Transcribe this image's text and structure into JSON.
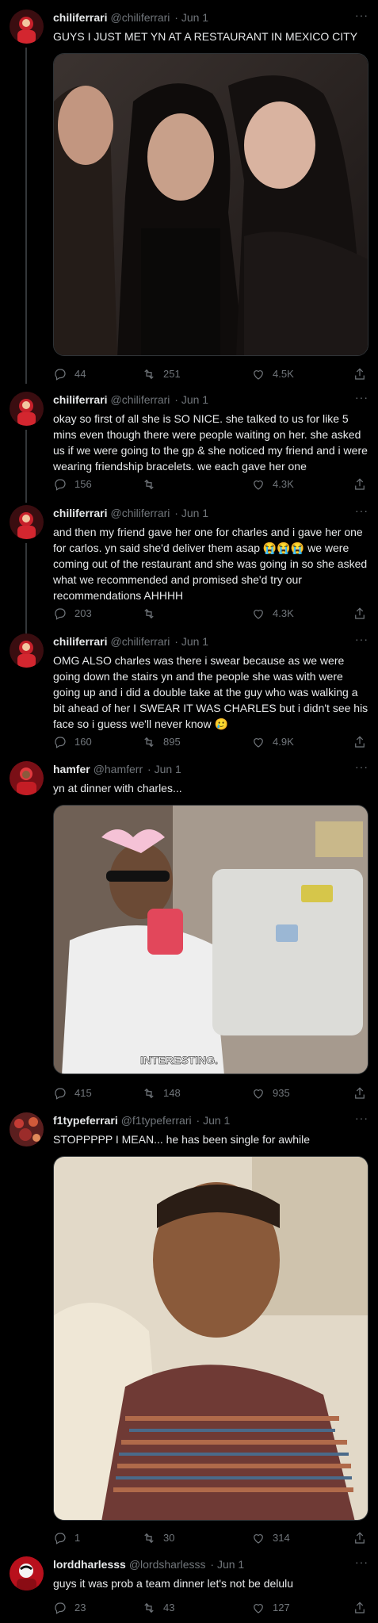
{
  "tweets": [
    {
      "name": "chiliferrari",
      "handle": "@chiliferrari",
      "date": "· Jun 1",
      "text": "GUYS I JUST MET YN AT A RESTAURANT IN MEXICO CITY",
      "replies": "44",
      "retweets": "251",
      "likes": "4.5K"
    },
    {
      "name": "chiliferrari",
      "handle": "@chiliferrari",
      "date": "· Jun 1",
      "text": "okay so first of all she is SO NICE. she talked to us for like 5 mins even though there were people waiting on her. she asked us if we were going to the gp & she noticed my friend and i were wearing friendship bracelets. we each gave her one",
      "replies": "156",
      "retweets": "",
      "likes": "4.3K"
    },
    {
      "name": "chiliferrari",
      "handle": "@chiliferrari",
      "date": "· Jun 1",
      "text": "and then my friend gave her one for charles and i gave her one for carlos. yn said she'd deliver them asap 😭😭😭  we were coming out of the restaurant and she was going in so she asked what we recommended and promised she'd try our recommendations AHHHH",
      "replies": "203",
      "retweets": "",
      "likes": "4.3K"
    },
    {
      "name": "chiliferrari",
      "handle": "@chiliferrari",
      "date": "· Jun 1",
      "text": "OMG ALSO charles was there i swear because as we were going down the stairs yn and the people she was with were going up and i did a double take at the guy who was walking a bit ahead of her I SWEAR IT WAS CHARLES  but i didn't see his face so i guess we'll never know 🥲",
      "replies": "160",
      "retweets": "895",
      "likes": "4.9K"
    },
    {
      "name": "hamfer",
      "handle": "@hamferr",
      "date": "· Jun 1",
      "text": "yn at dinner with charles...",
      "caption": "INTERESTING.",
      "replies": "415",
      "retweets": "148",
      "likes": "935"
    },
    {
      "name": "f1typeferrari",
      "handle": "@f1typeferrari",
      "date": "· Jun 1",
      "text": "STOPPPPP I MEAN... he has been single for awhile",
      "replies": "1",
      "retweets": "30",
      "likes": "314"
    },
    {
      "name": "lorddharlesss",
      "handle": "@lordsharlesss",
      "date": "· Jun 1",
      "text": "guys it was prob a team dinner let's not be delulu",
      "replies": "23",
      "retweets": "43",
      "likes": "127"
    }
  ],
  "more_label": "···",
  "colors": {
    "background": "#000000",
    "text": "#e7e9ea",
    "muted": "#71767b",
    "divider": "#2f3336"
  }
}
